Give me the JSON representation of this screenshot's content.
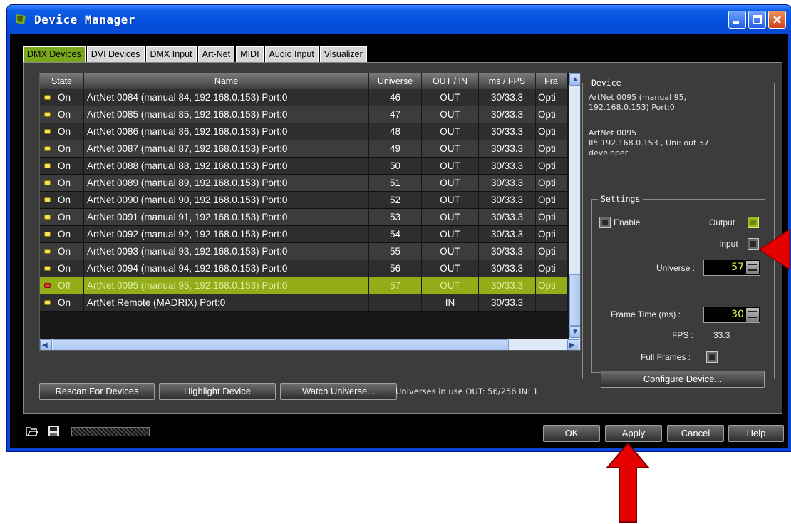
{
  "window": {
    "title": "Device Manager"
  },
  "tabs": [
    "DMX Devices",
    "DVI Devices",
    "DMX Input",
    "Art-Net",
    "MIDI",
    "Audio Input",
    "Visualizer"
  ],
  "grid": {
    "columns": [
      "State",
      "Name",
      "Universe",
      "OUT / IN",
      "ms / FPS",
      "Fra"
    ],
    "rows": [
      {
        "state": "On",
        "name": "ArtNet 0084 (manual 84, 192.168.0.153) Port:0",
        "universe": "46",
        "outin": "OUT",
        "ms": "30/33.3",
        "frame": "Opti"
      },
      {
        "state": "On",
        "name": "ArtNet 0085 (manual 85, 192.168.0.153) Port:0",
        "universe": "47",
        "outin": "OUT",
        "ms": "30/33.3",
        "frame": "Opti"
      },
      {
        "state": "On",
        "name": "ArtNet 0086 (manual 86, 192.168.0.153) Port:0",
        "universe": "48",
        "outin": "OUT",
        "ms": "30/33.3",
        "frame": "Opti"
      },
      {
        "state": "On",
        "name": "ArtNet 0087 (manual 87, 192.168.0.153) Port:0",
        "universe": "49",
        "outin": "OUT",
        "ms": "30/33.3",
        "frame": "Opti"
      },
      {
        "state": "On",
        "name": "ArtNet 0088 (manual 88, 192.168.0.153) Port:0",
        "universe": "50",
        "outin": "OUT",
        "ms": "30/33.3",
        "frame": "Opti"
      },
      {
        "state": "On",
        "name": "ArtNet 0089 (manual 89, 192.168.0.153) Port:0",
        "universe": "51",
        "outin": "OUT",
        "ms": "30/33.3",
        "frame": "Opti"
      },
      {
        "state": "On",
        "name": "ArtNet 0090 (manual 90, 192.168.0.153) Port:0",
        "universe": "52",
        "outin": "OUT",
        "ms": "30/33.3",
        "frame": "Opti"
      },
      {
        "state": "On",
        "name": "ArtNet 0091 (manual 91, 192.168.0.153) Port:0",
        "universe": "53",
        "outin": "OUT",
        "ms": "30/33.3",
        "frame": "Opti"
      },
      {
        "state": "On",
        "name": "ArtNet 0092 (manual 92, 192.168.0.153) Port:0",
        "universe": "54",
        "outin": "OUT",
        "ms": "30/33.3",
        "frame": "Opti"
      },
      {
        "state": "On",
        "name": "ArtNet 0093 (manual 93, 192.168.0.153) Port:0",
        "universe": "55",
        "outin": "OUT",
        "ms": "30/33.3",
        "frame": "Opti"
      },
      {
        "state": "On",
        "name": "ArtNet 0094 (manual 94, 192.168.0.153) Port:0",
        "universe": "56",
        "outin": "OUT",
        "ms": "30/33.3",
        "frame": "Opti"
      },
      {
        "state": "Off",
        "name": "ArtNet 0095 (manual 95, 192.168.0.153) Port:0",
        "universe": "57",
        "outin": "OUT",
        "ms": "30/33.3",
        "frame": "Opti",
        "selected": true
      },
      {
        "state": "On",
        "name": "ArtNet Remote (MADRIX) Port:0",
        "universe": "",
        "outin": "IN",
        "ms": "30/33.3",
        "frame": ""
      }
    ]
  },
  "buttons": {
    "rescan": "Rescan For Devices",
    "highlight": "Highlight Device",
    "watch": "Watch Universe...",
    "ok": "OK",
    "apply": "Apply",
    "cancel": "Cancel",
    "help": "Help",
    "configure": "Configure Device..."
  },
  "status": {
    "universes": "Universes in use OUT: 56/256  IN: 1"
  },
  "device": {
    "legend": "Device",
    "line1": "ArtNet 0095 (manual 95,",
    "line2": "192.168.0.153) Port:0",
    "line3": "ArtNet 0095",
    "line4": "IP: 192.168.0.153 , Uni: out 57",
    "line5": "developer"
  },
  "settings": {
    "legend": "Settings",
    "enable": "Enable",
    "output": "Output",
    "input": "Input",
    "universe_label": "Universe :",
    "universe_value": "57",
    "frame_label": "Frame Time (ms) :",
    "frame_value": "30",
    "fps_label": "FPS :",
    "fps_value": "33.3",
    "full_frames": "Full Frames :"
  },
  "colors": {
    "accent": "#93ad19",
    "title_blue": "#0450dc",
    "annotation_arrow": "#e60000"
  }
}
